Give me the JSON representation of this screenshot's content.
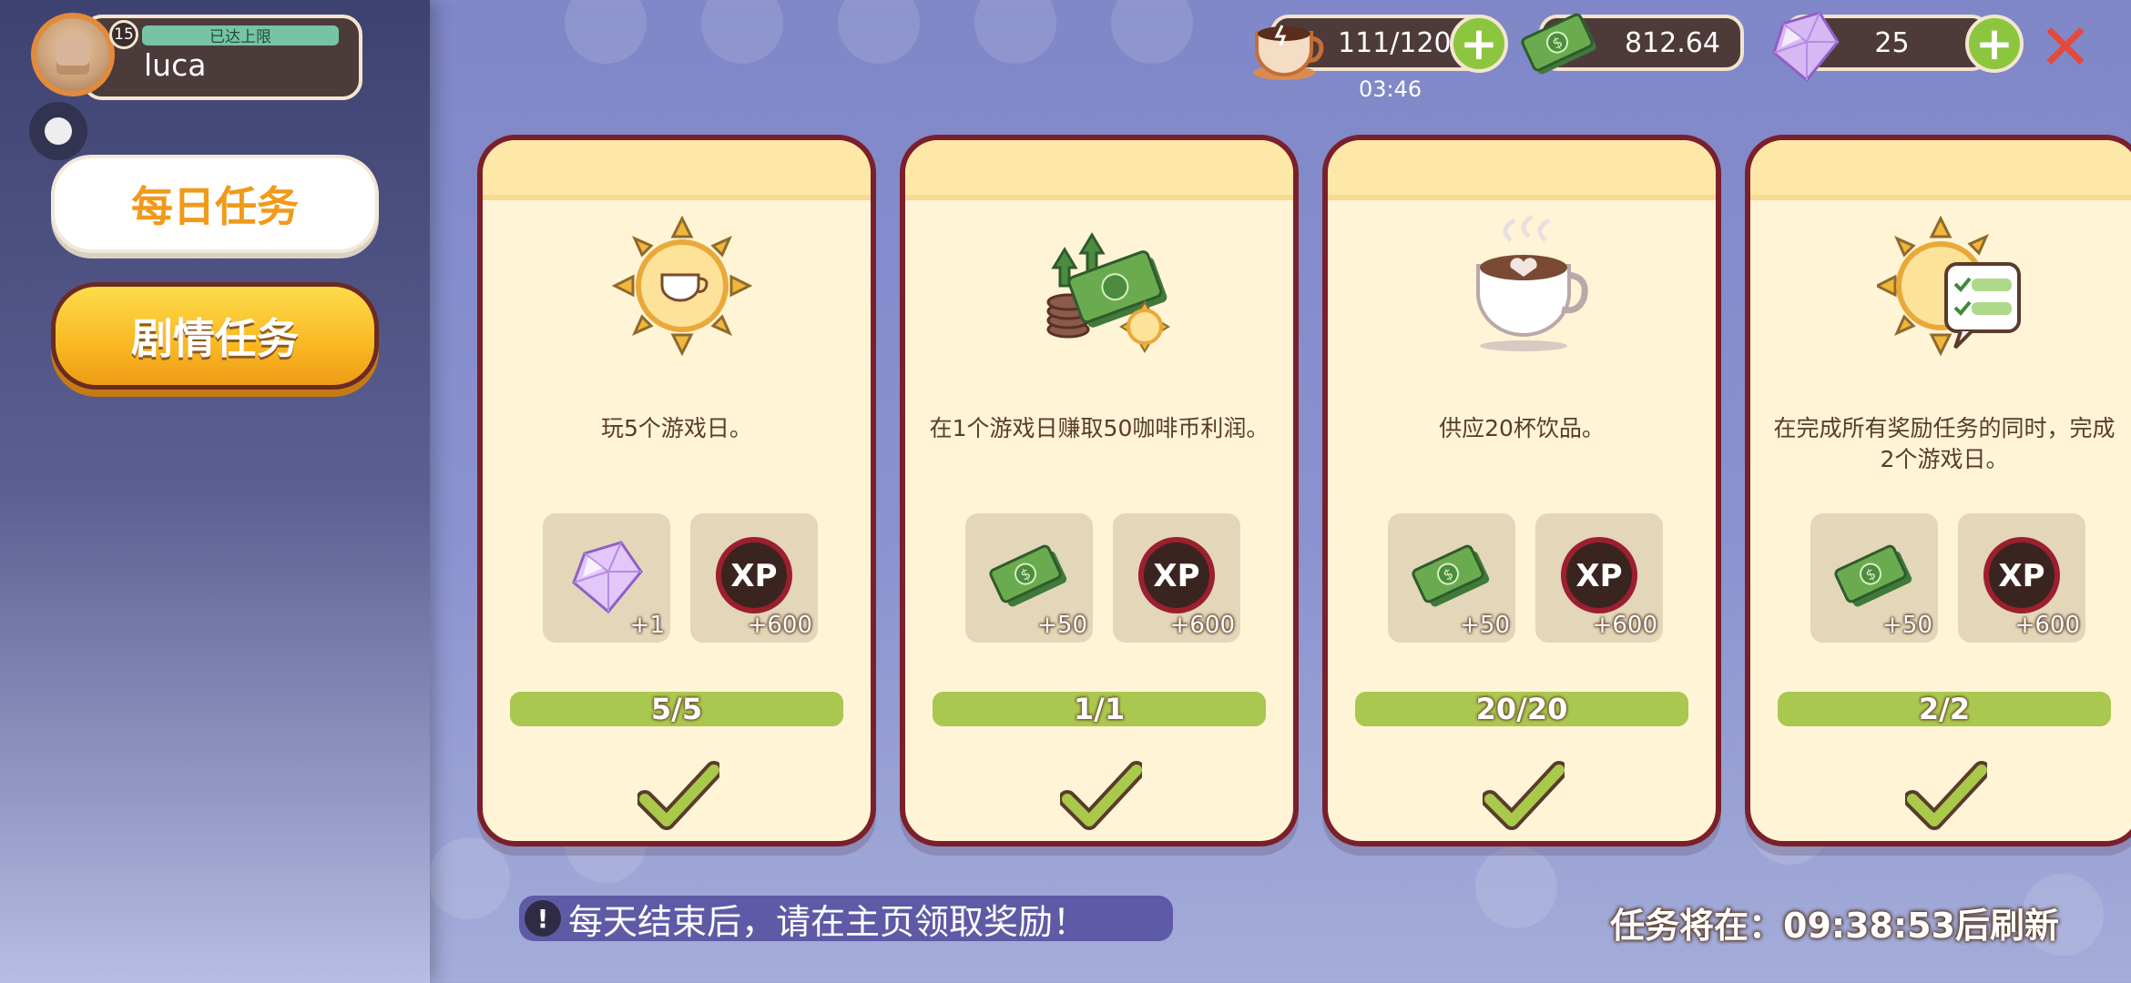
{
  "player": {
    "level": "15",
    "xp_label": "已达上限",
    "name": "luca"
  },
  "sidebar": {
    "tabs": [
      {
        "label": "每日任务"
      },
      {
        "label": "剧情任务"
      }
    ]
  },
  "currencies": {
    "energy": {
      "value": "111/120",
      "timer": "03:46",
      "icon": "coffee-icon"
    },
    "cash": {
      "value": "812.64",
      "icon": "cash-icon"
    },
    "gems": {
      "value": "25",
      "icon": "gem-icon"
    }
  },
  "quests": [
    {
      "icon": "sun-coffee-icon",
      "desc": "玩5个游戏日。",
      "rewards": [
        {
          "type": "gem",
          "amount": "+1"
        },
        {
          "type": "xp",
          "amount": "+600"
        }
      ],
      "progress": "5/5",
      "progress_fraction": 1,
      "completed": true
    },
    {
      "icon": "cash-growth-icon",
      "desc": "在1个游戏日赚取50咖啡币利润。",
      "rewards": [
        {
          "type": "cash",
          "amount": "+50"
        },
        {
          "type": "xp",
          "amount": "+600"
        }
      ],
      "progress": "1/1",
      "progress_fraction": 1,
      "completed": true
    },
    {
      "icon": "latte-icon",
      "desc": "供应20杯饮品。",
      "rewards": [
        {
          "type": "cash",
          "amount": "+50"
        },
        {
          "type": "xp",
          "amount": "+600"
        }
      ],
      "progress": "20/20",
      "progress_fraction": 1,
      "completed": true
    },
    {
      "icon": "sun-checklist-icon",
      "desc": "在完成所有奖励任务的同时，完成2个游戏日。",
      "rewards": [
        {
          "type": "cash",
          "amount": "+50"
        },
        {
          "type": "xp",
          "amount": "+600"
        }
      ],
      "progress": "2/2",
      "progress_fraction": 1,
      "completed": true
    }
  ],
  "footer": {
    "notice": "每天结束后，请在主页领取奖励！",
    "refresh": "任务将在：09:38:53后刷新"
  },
  "colors": {
    "card_border": "#7b1f2b",
    "progress_green": "#aac84f",
    "tab_active_text": "#f19a1a",
    "tab_story_bg": "#f9b822"
  }
}
